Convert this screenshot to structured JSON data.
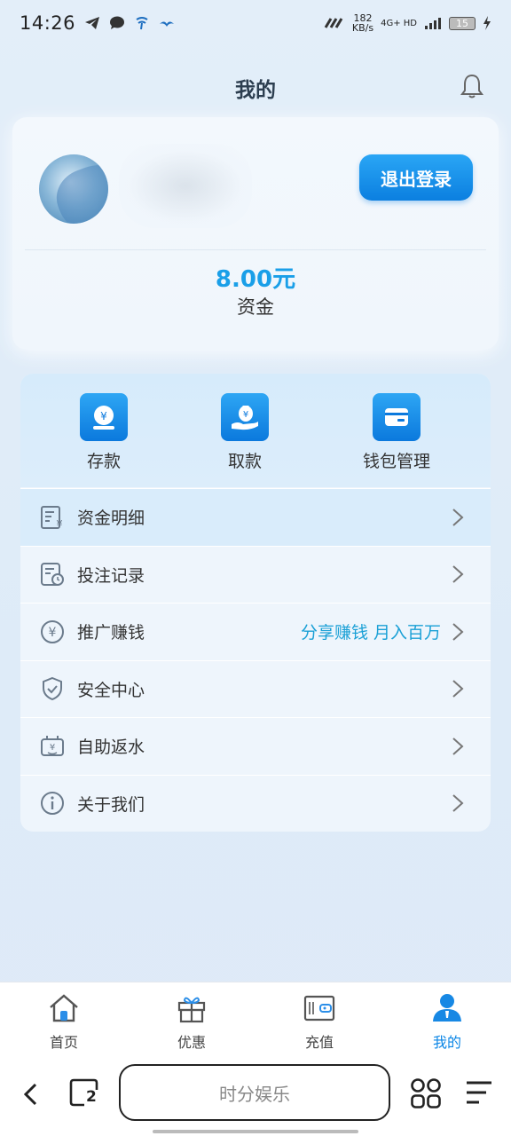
{
  "status_bar": {
    "time": "14:26",
    "net_speed_value": "182",
    "net_speed_unit": "KB/s",
    "network": "4G+ HD",
    "battery": "15"
  },
  "header": {
    "title": "我的"
  },
  "profile": {
    "logout_label": "退出登录",
    "balance": "8.00元",
    "balance_label": "资金"
  },
  "actions": [
    {
      "label": "存款",
      "icon": "deposit-icon"
    },
    {
      "label": "取款",
      "icon": "withdraw-icon"
    },
    {
      "label": "钱包管理",
      "icon": "wallet-card-icon"
    }
  ],
  "menu": [
    {
      "label": "资金明细",
      "icon": "fund-details-icon",
      "extra": ""
    },
    {
      "label": "投注记录",
      "icon": "bet-record-icon",
      "extra": ""
    },
    {
      "label": "推广赚钱",
      "icon": "yen-circle-icon",
      "extra": "分享赚钱 月入百万"
    },
    {
      "label": "安全中心",
      "icon": "shield-check-icon",
      "extra": ""
    },
    {
      "label": "自助返水",
      "icon": "rebate-icon",
      "extra": ""
    },
    {
      "label": "关于我们",
      "icon": "info-icon",
      "extra": ""
    }
  ],
  "bottom_nav": [
    {
      "label": "首页",
      "icon": "home-icon",
      "active": false
    },
    {
      "label": "优惠",
      "icon": "gift-icon",
      "active": false
    },
    {
      "label": "充值",
      "icon": "recharge-wallet-icon",
      "active": false
    },
    {
      "label": "我的",
      "icon": "user-icon",
      "active": true
    }
  ],
  "browser": {
    "search_text": "时分娱乐",
    "tab_count": "2"
  },
  "colors": {
    "accent": "#1a9fe8",
    "button": "#0b7fe0",
    "promo_text": "#1aa0d6"
  }
}
